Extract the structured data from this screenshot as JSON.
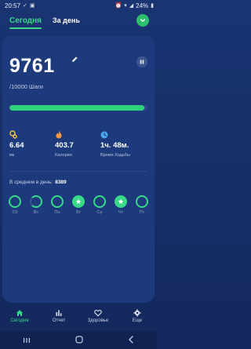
{
  "status_bar": {
    "time": "20:57",
    "battery": "24%"
  },
  "tabs": {
    "today": "Сегодня",
    "per_day": "За день"
  },
  "steps": {
    "value": "9761",
    "goal_text": "/10000 Шаги",
    "progress": 0.976
  },
  "stats": [
    {
      "value": "6.64",
      "label": "км",
      "icon": "location-pin-icon",
      "color": "#f2c94c"
    },
    {
      "value": "403.7",
      "label": "Калории",
      "icon": "flame-icon",
      "color": "#f2994a"
    },
    {
      "value": "1ч. 48м.",
      "label": "Время Ходьбы",
      "icon": "clock-icon",
      "color": "#4aa8f0"
    }
  ],
  "average": {
    "label": "В среднем в день:",
    "value": "8389"
  },
  "week": [
    {
      "label": "Сб",
      "state": "ring"
    },
    {
      "label": "Вс",
      "state": "partial"
    },
    {
      "label": "Пн",
      "state": "ring"
    },
    {
      "label": "Вт",
      "state": "star"
    },
    {
      "label": "Ср",
      "state": "ring"
    },
    {
      "label": "Чт",
      "state": "star"
    },
    {
      "label": "Пт",
      "state": "ring"
    }
  ],
  "nav": {
    "today": "Сегодня",
    "report": "Отчет",
    "health": "Здоровье",
    "more": "Еще"
  },
  "colors": {
    "accent": "#39d98a",
    "background": "#17306b",
    "card": "#1d3a7c"
  }
}
